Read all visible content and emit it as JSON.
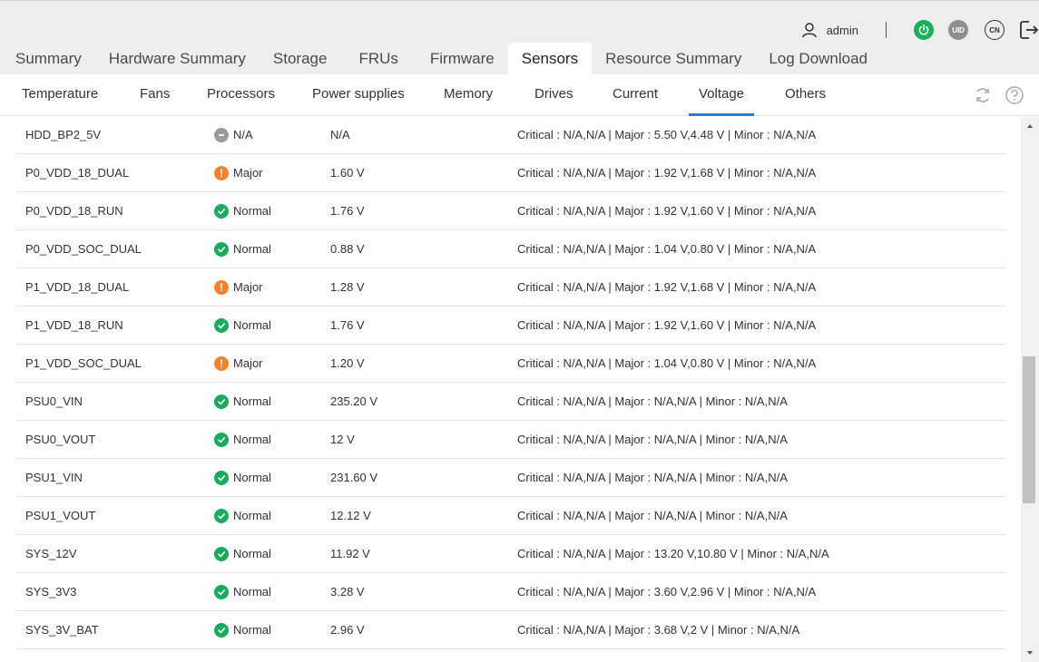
{
  "header": {
    "user": "admin",
    "uid_label": "UID",
    "lang_label": "CN"
  },
  "main_tabs": [
    "Summary",
    "Hardware Summary",
    "Storage",
    "FRUs",
    "Firmware",
    "Sensors",
    "Resource Summary",
    "Log Download"
  ],
  "active_main_tab": "Sensors",
  "sub_tabs": [
    "Temperature",
    "Fans",
    "Processors",
    "Power supplies",
    "Memory",
    "Drives",
    "Current",
    "Voltage",
    "Others"
  ],
  "active_sub_tab": "Voltage",
  "rows": [
    {
      "name": "HDD_BP2_5V",
      "status": "N/A",
      "value": "N/A",
      "thresholds": "Critical : N/A,N/A | Major : 5.50 V,4.48 V | Minor : N/A,N/A"
    },
    {
      "name": "P0_VDD_18_DUAL",
      "status": "Major",
      "value": "1.60 V",
      "thresholds": "Critical : N/A,N/A | Major : 1.92 V,1.68 V | Minor : N/A,N/A"
    },
    {
      "name": "P0_VDD_18_RUN",
      "status": "Normal",
      "value": "1.76 V",
      "thresholds": "Critical : N/A,N/A | Major : 1.92 V,1.60 V | Minor : N/A,N/A"
    },
    {
      "name": "P0_VDD_SOC_DUAL",
      "status": "Normal",
      "value": "0.88 V",
      "thresholds": "Critical : N/A,N/A | Major : 1.04 V,0.80 V | Minor : N/A,N/A"
    },
    {
      "name": "P1_VDD_18_DUAL",
      "status": "Major",
      "value": "1.28 V",
      "thresholds": "Critical : N/A,N/A | Major : 1.92 V,1.68 V | Minor : N/A,N/A"
    },
    {
      "name": "P1_VDD_18_RUN",
      "status": "Normal",
      "value": "1.76 V",
      "thresholds": "Critical : N/A,N/A | Major : 1.92 V,1.60 V | Minor : N/A,N/A"
    },
    {
      "name": "P1_VDD_SOC_DUAL",
      "status": "Major",
      "value": "1.20 V",
      "thresholds": "Critical : N/A,N/A | Major : 1.04 V,0.80 V | Minor : N/A,N/A"
    },
    {
      "name": "PSU0_VIN",
      "status": "Normal",
      "value": "235.20 V",
      "thresholds": "Critical : N/A,N/A | Major : N/A,N/A | Minor : N/A,N/A"
    },
    {
      "name": "PSU0_VOUT",
      "status": "Normal",
      "value": "12 V",
      "thresholds": "Critical : N/A,N/A | Major : N/A,N/A | Minor : N/A,N/A"
    },
    {
      "name": "PSU1_VIN",
      "status": "Normal",
      "value": "231.60 V",
      "thresholds": "Critical : N/A,N/A | Major : N/A,N/A | Minor : N/A,N/A"
    },
    {
      "name": "PSU1_VOUT",
      "status": "Normal",
      "value": "12.12 V",
      "thresholds": "Critical : N/A,N/A | Major : N/A,N/A | Minor : N/A,N/A"
    },
    {
      "name": "SYS_12V",
      "status": "Normal",
      "value": "11.92 V",
      "thresholds": "Critical : N/A,N/A | Major : 13.20 V,10.80 V | Minor : N/A,N/A"
    },
    {
      "name": "SYS_3V3",
      "status": "Normal",
      "value": "3.28 V",
      "thresholds": "Critical : N/A,N/A | Major : 3.60 V,2.96 V | Minor : N/A,N/A"
    },
    {
      "name": "SYS_3V_BAT",
      "status": "Normal",
      "value": "2.96 V",
      "thresholds": "Critical : N/A,N/A | Major : 3.68 V,2 V | Minor : N/A,N/A"
    }
  ],
  "colors": {
    "accent": "#2b7bd1",
    "normal": "#1aab60",
    "major": "#f5822a",
    "na": "#9a9a9a",
    "power": "#18b15b"
  },
  "icons": {
    "user": "user-icon",
    "power": "power-icon",
    "uid": "uid-icon",
    "lang": "language-icon",
    "logout": "logout-icon",
    "refresh": "refresh-icon",
    "help": "help-icon"
  }
}
